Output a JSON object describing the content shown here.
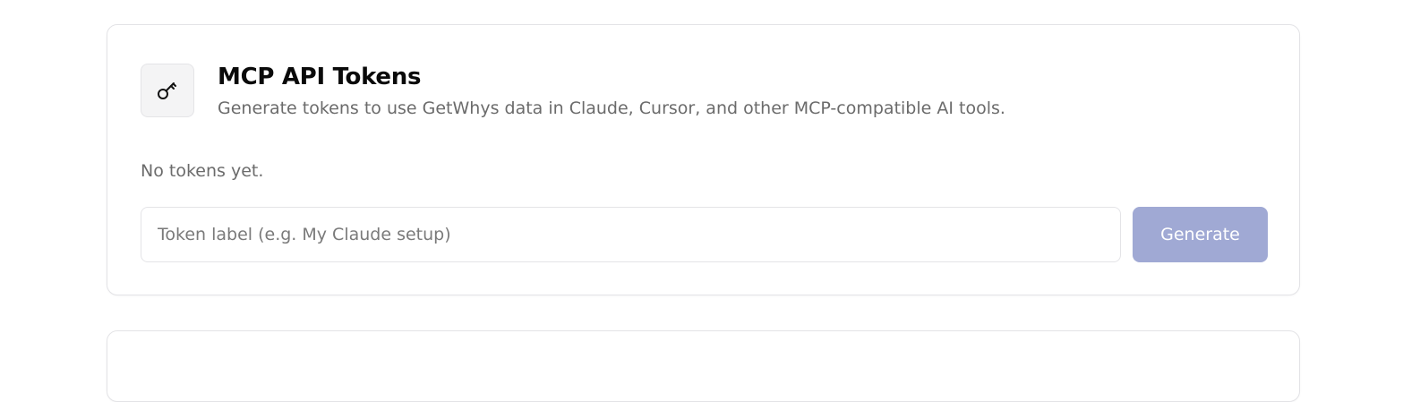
{
  "tokens_card": {
    "icon": "key-icon",
    "title": "MCP API Tokens",
    "subtitle": "Generate tokens to use GetWhys data in Claude, Cursor, and other MCP-compatible AI tools.",
    "empty_state": "No tokens yet.",
    "token_input": {
      "value": "",
      "placeholder": "Token label (e.g. My Claude setup)"
    },
    "generate_label": "Generate",
    "generate_disabled": true
  },
  "colors": {
    "generate_button": "#a0a9d4",
    "card_border": "#e3e3e6",
    "muted_text": "#6b6b6b"
  }
}
